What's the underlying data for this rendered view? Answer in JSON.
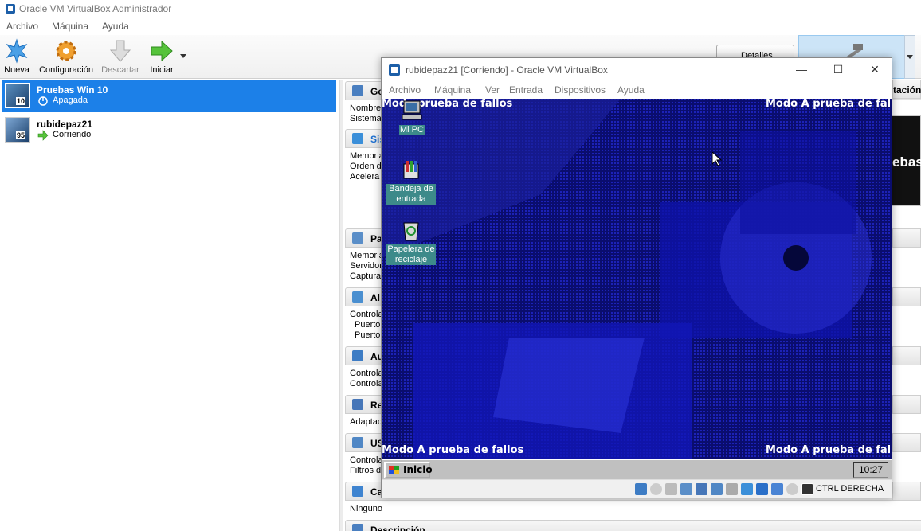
{
  "manager": {
    "title": "Oracle VM VirtualBox Administrador",
    "menu": [
      "Archivo",
      "Máquina",
      "Ayuda"
    ],
    "toolbar": {
      "nueva": "Nueva",
      "configuracion": "Configuración",
      "descartar": "Descartar",
      "iniciar": "Iniciar"
    },
    "detalles_label": "Detalles",
    "vms": [
      {
        "name": "Pruebas Win 10",
        "state": "Apagada",
        "badge": "10"
      },
      {
        "name": "rubidepaz21",
        "state": "Corriendo",
        "badge": "95"
      }
    ],
    "sections": {
      "general": {
        "title": "Ge",
        "rows": [
          "Nombre",
          "Sistema"
        ]
      },
      "sistema": {
        "title": "Sis",
        "rows": [
          "Memoria",
          "Orden d",
          "Acelera"
        ]
      },
      "pantalla": {
        "title": "Pa",
        "rows": [
          "Memoria",
          "Servidor",
          "Captura"
        ]
      },
      "almacenamiento": {
        "title": "Al",
        "rows": [
          "Controla",
          "Puerto",
          "Puerto"
        ]
      },
      "audio": {
        "title": "Au",
        "rows": [
          "Controla",
          "Controla"
        ]
      },
      "red": {
        "title": "Re",
        "rows": [
          "Adaptad"
        ]
      },
      "usb": {
        "title": "US",
        "rows": [
          "Controla",
          "Filtros d"
        ]
      },
      "carpetas": {
        "title": "Ca",
        "rows": [
          "Ninguno"
        ]
      },
      "descripcion": {
        "title": "Descripción"
      }
    },
    "right_fragments": {
      "ratacion": "tación",
      "preview": "ebas"
    }
  },
  "vmwindow": {
    "title": "rubidepaz21 [Corriendo] - Oracle VM VirtualBox",
    "menu": [
      "Archivo",
      "Máquina",
      "Ver",
      "Entrada",
      "Dispositivos",
      "Ayuda"
    ],
    "safe_mode": "Modo A prueba de fallos",
    "safe_mode_partial": "Mod",
    "safe_mode_rest": "prueba de fallos",
    "desktop_icons": [
      {
        "label": "Mi PC",
        "icon": "my-computer-icon"
      },
      {
        "label": "Bandeja de entrada",
        "icon": "inbox-icon"
      },
      {
        "label": "Papelera de reciclaje",
        "icon": "recycle-bin-icon"
      }
    ],
    "start": "Inicio",
    "clock": "10:27",
    "host_key": "CTRL DERECHA"
  },
  "colors": {
    "selection": "#1c80e8",
    "desktop": "#0b0f7a",
    "accent_blue": "#1c80e8"
  }
}
